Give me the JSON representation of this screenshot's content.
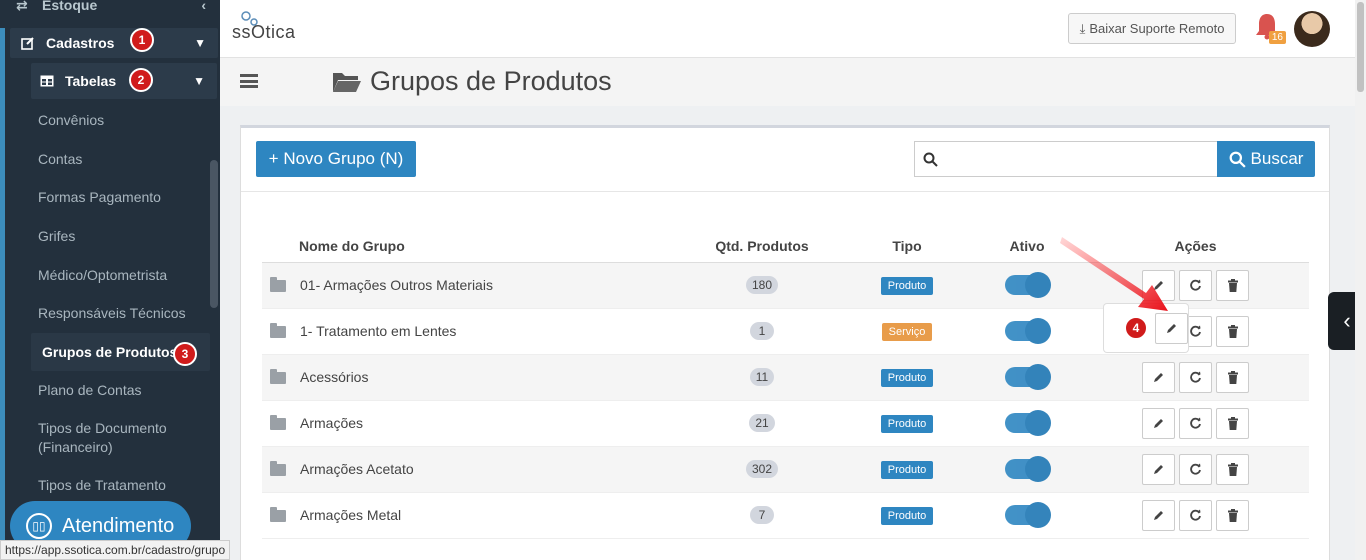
{
  "sidebar": {
    "top_item": "Estoque",
    "cadastros": {
      "label": "Cadastros",
      "badge": "1"
    },
    "tabelas": {
      "label": "Tabelas",
      "badge": "2"
    },
    "items": [
      {
        "label": "Convênios"
      },
      {
        "label": "Contas"
      },
      {
        "label": "Formas Pagamento"
      },
      {
        "label": "Grifes"
      },
      {
        "label": "Médico/Optometrista"
      },
      {
        "label": "Responsáveis Técnicos"
      },
      {
        "label": "Grupos de Produtos",
        "badge": "3"
      },
      {
        "label": "Plano de Contas"
      },
      {
        "label": "Tipos de Documento (Financeiro)"
      },
      {
        "label": "Tipos de Tratamento"
      }
    ],
    "atendimento": "Atendimento"
  },
  "status_url": "https://app.ssotica.com.br/cadastro/grupo",
  "header": {
    "logo": "ssOtica",
    "suporte_button": "Baixar Suporte Remoto",
    "notif_count": "16"
  },
  "page": {
    "title": "Grupos de Produtos",
    "novo_button": "+ Novo Grupo (N)",
    "search_placeholder": "",
    "buscar_button": "Buscar"
  },
  "table": {
    "headers": [
      "Nome do Grupo",
      "Qtd. Produtos",
      "Tipo",
      "Ativo",
      "Ações"
    ],
    "rows": [
      {
        "name": "01- Armações Outros Materiais",
        "qty": "180",
        "tipo": "Produto",
        "tipo_kind": "produto"
      },
      {
        "name": "1- Tratamento em Lentes",
        "qty": "1",
        "tipo": "Serviço",
        "tipo_kind": "servico"
      },
      {
        "name": "Acessórios",
        "qty": "11",
        "tipo": "Produto",
        "tipo_kind": "produto"
      },
      {
        "name": "Armações",
        "qty": "21",
        "tipo": "Produto",
        "tipo_kind": "produto"
      },
      {
        "name": "Armações Acetato",
        "qty": "302",
        "tipo": "Produto",
        "tipo_kind": "produto"
      },
      {
        "name": "Armações Metal",
        "qty": "7",
        "tipo": "Produto",
        "tipo_kind": "produto"
      }
    ]
  },
  "annotation_badge": "4",
  "colors": {
    "accent": "#2e86c1",
    "sidebar": "#23303d",
    "badge": "#d01b1b",
    "servico": "#e89c4a"
  }
}
